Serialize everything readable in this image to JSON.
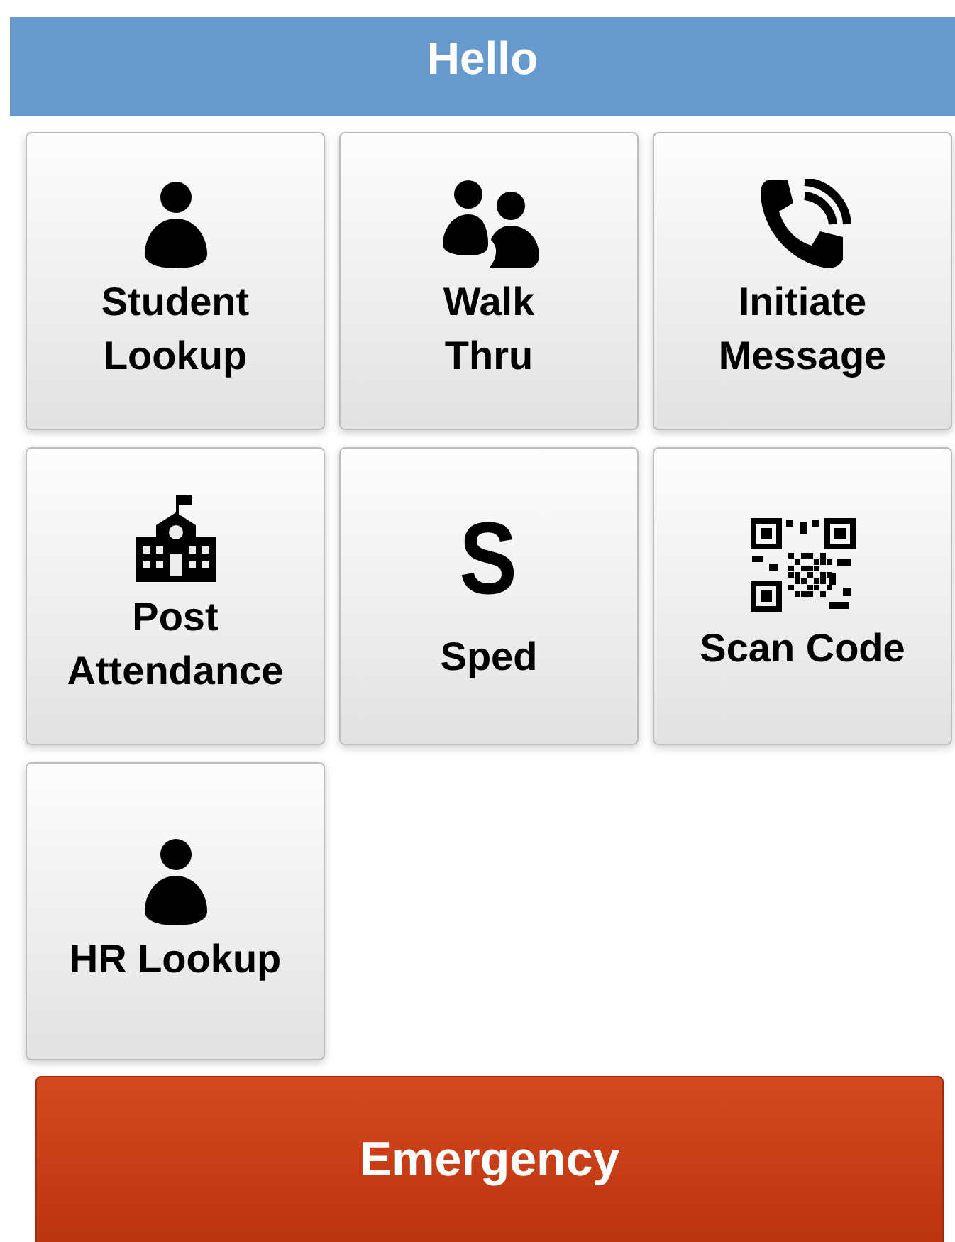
{
  "header": {
    "title": "Hello"
  },
  "tiles": [
    {
      "label": "Student Lookup",
      "kind": "person"
    },
    {
      "label": "Walk\nThru",
      "kind": "people"
    },
    {
      "label": "Initiate Message",
      "kind": "phone"
    },
    {
      "label": "Post Attendance",
      "kind": "school"
    },
    {
      "label": "Sped",
      "kind": "letter",
      "glyph": "S"
    },
    {
      "label": "Scan Code",
      "kind": "qr"
    },
    {
      "label": "HR Lookup",
      "kind": "person"
    }
  ],
  "emergency_button": {
    "label": "Emergency"
  }
}
